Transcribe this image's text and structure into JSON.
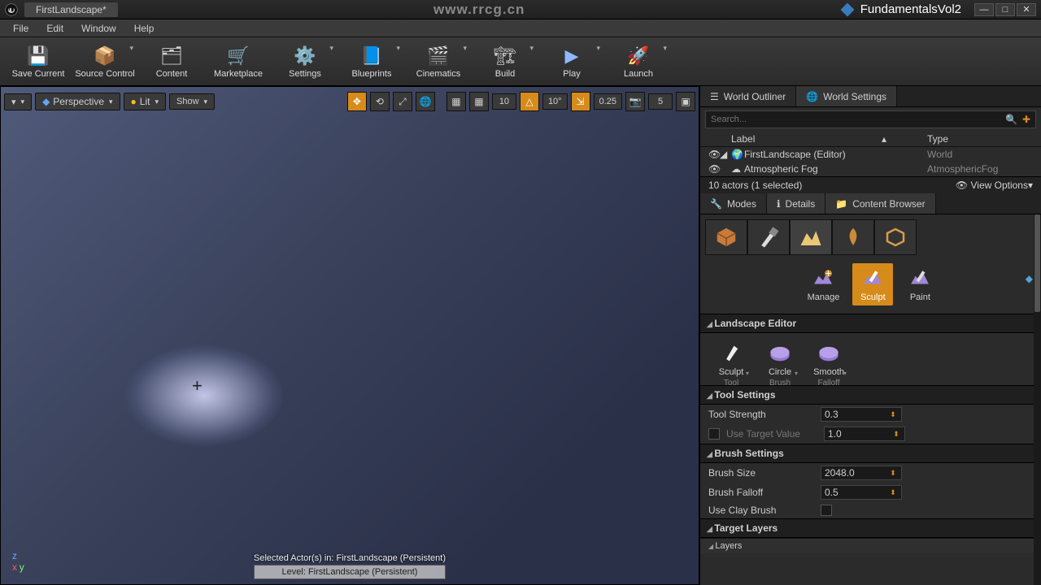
{
  "titlebar": {
    "tab_title": "FirstLandscape*",
    "center_text": "www.rrcg.cn",
    "project_name": "FundamentalsVol2"
  },
  "menubar": [
    "File",
    "Edit",
    "Window",
    "Help"
  ],
  "toolbar": [
    {
      "label": "Save Current",
      "icon": "💾",
      "dd": false
    },
    {
      "label": "Source Control",
      "icon": "📦",
      "dd": true
    },
    {
      "label": "Content",
      "icon": "🗂",
      "dd": false
    },
    {
      "label": "Marketplace",
      "icon": "🛒",
      "dd": false
    },
    {
      "label": "Settings",
      "icon": "⚙️",
      "dd": true
    },
    {
      "label": "Blueprints",
      "icon": "📘",
      "dd": true
    },
    {
      "label": "Cinematics",
      "icon": "🎬",
      "dd": true
    },
    {
      "label": "Build",
      "icon": "🏗",
      "dd": true
    },
    {
      "label": "Play",
      "icon": "▶",
      "dd": true
    },
    {
      "label": "Launch",
      "icon": "🚀",
      "dd": true
    }
  ],
  "viewport": {
    "perspective": "Perspective",
    "viewmode": "Lit",
    "show": "Show",
    "grid_num": "10",
    "angle_num": "10°",
    "scale_num": "0.25",
    "cam_num": "5",
    "selected_actors": "Selected Actor(s) in:  FirstLandscape (Persistent)",
    "level": "Level:  FirstLandscape (Persistent)"
  },
  "outliner": {
    "tab1": "World Outliner",
    "tab2": "World Settings",
    "search_placeholder": "Search...",
    "col_label": "Label",
    "col_type": "Type",
    "rows": [
      {
        "label": "FirstLandscape (Editor)",
        "type": "World"
      },
      {
        "label": "Atmospheric Fog",
        "type": "AtmosphericFog"
      }
    ],
    "footer_count": "10 actors (1 selected)",
    "footer_view": "View Options"
  },
  "rtabs2": {
    "modes": "Modes",
    "details": "Details",
    "content": "Content Browser"
  },
  "mode_tools": {
    "manage": "Manage",
    "sculpt": "Sculpt",
    "paint": "Paint"
  },
  "landscape_editor": {
    "header": "Landscape Editor",
    "tools": [
      {
        "l1": "Sculpt",
        "l2": "Tool"
      },
      {
        "l1": "Circle",
        "l2": "Brush"
      },
      {
        "l1": "Smooth",
        "l2": "Falloff"
      }
    ]
  },
  "tool_settings": {
    "header": "Tool Settings",
    "strength_label": "Tool Strength",
    "strength_val": "0.3",
    "target_label": "Use Target Value",
    "target_val": "1.0"
  },
  "brush_settings": {
    "header": "Brush Settings",
    "size_label": "Brush Size",
    "size_val": "2048.0",
    "falloff_label": "Brush Falloff",
    "falloff_val": "0.5",
    "clay_label": "Use Clay Brush"
  },
  "target_layers": {
    "header": "Target Layers",
    "sub": "Layers"
  }
}
